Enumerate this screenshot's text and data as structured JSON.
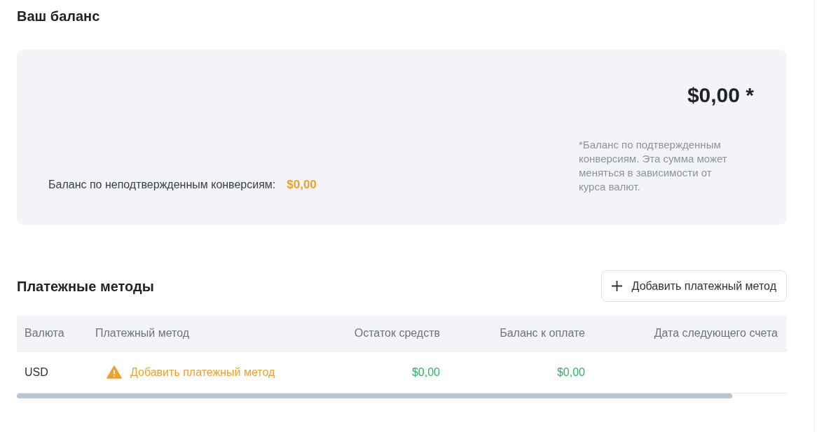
{
  "balance": {
    "title": "Ваш баланс",
    "total": "$0,00 *",
    "footnote": "*Баланс по подтвержденным конверсиям. Эта сумма может меняться в зависимости от курса валют.",
    "unconfirmed": {
      "label": "Баланс по неподтвержденным конверсиям:",
      "amount": "$0,00"
    }
  },
  "payment_methods": {
    "title": "Платежные методы",
    "add_button": "Добавить платежный метод",
    "table": {
      "columns": [
        "Валюта",
        "Платежный метод",
        "Остаток средств",
        "Баланс к оплате",
        "Дата следующего счета"
      ],
      "rows": [
        {
          "currency": "USD",
          "payment_method": {
            "text": "Добавить платежный метод",
            "warning": true
          },
          "remaining": "$0,00",
          "balance_due": "$0,00"
        }
      ]
    }
  }
}
